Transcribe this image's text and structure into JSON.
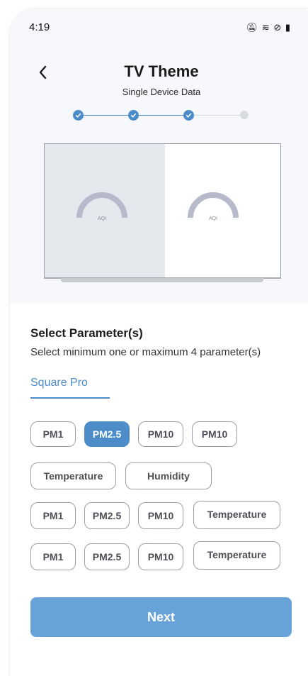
{
  "status_bar": {
    "time": "4:19",
    "icons": [
      "mute-icon",
      "wifi-icon",
      "dnd-icon",
      "battery-icon"
    ]
  },
  "header": {
    "title": "TV Theme",
    "subtitle": "Single Device Data"
  },
  "stepper": {
    "total_steps": 4,
    "completed_steps": 3
  },
  "preview": {
    "gauge_left_label": "AQI",
    "gauge_right_label": "AQI"
  },
  "parameters": {
    "title": "Select Parameter(s)",
    "subtitle": "Select minimum one or maximum 4 parameter(s)",
    "tab_label": "Square Pro",
    "chips": [
      {
        "label": "PM1",
        "selected": false
      },
      {
        "label": "PM2.5",
        "selected": true
      },
      {
        "label": "PM10",
        "selected": false
      },
      {
        "label": "PM10",
        "selected": false
      },
      {
        "label": "Temperature",
        "selected": false
      },
      {
        "label": "Humidity",
        "selected": false
      },
      {
        "label": "PM1",
        "selected": false
      },
      {
        "label": "PM2.5",
        "selected": false
      },
      {
        "label": "PM10",
        "selected": false
      },
      {
        "label": "Temperature",
        "selected": false
      },
      {
        "label": "PM1",
        "selected": false
      },
      {
        "label": "PM2.5",
        "selected": false
      },
      {
        "label": "PM10",
        "selected": false
      },
      {
        "label": "Temperature",
        "selected": false
      }
    ]
  },
  "footer": {
    "next_label": "Next"
  },
  "colors": {
    "accent": "#4b8cc9",
    "button": "#67a3d9",
    "chip_border": "#9aa0a8"
  }
}
